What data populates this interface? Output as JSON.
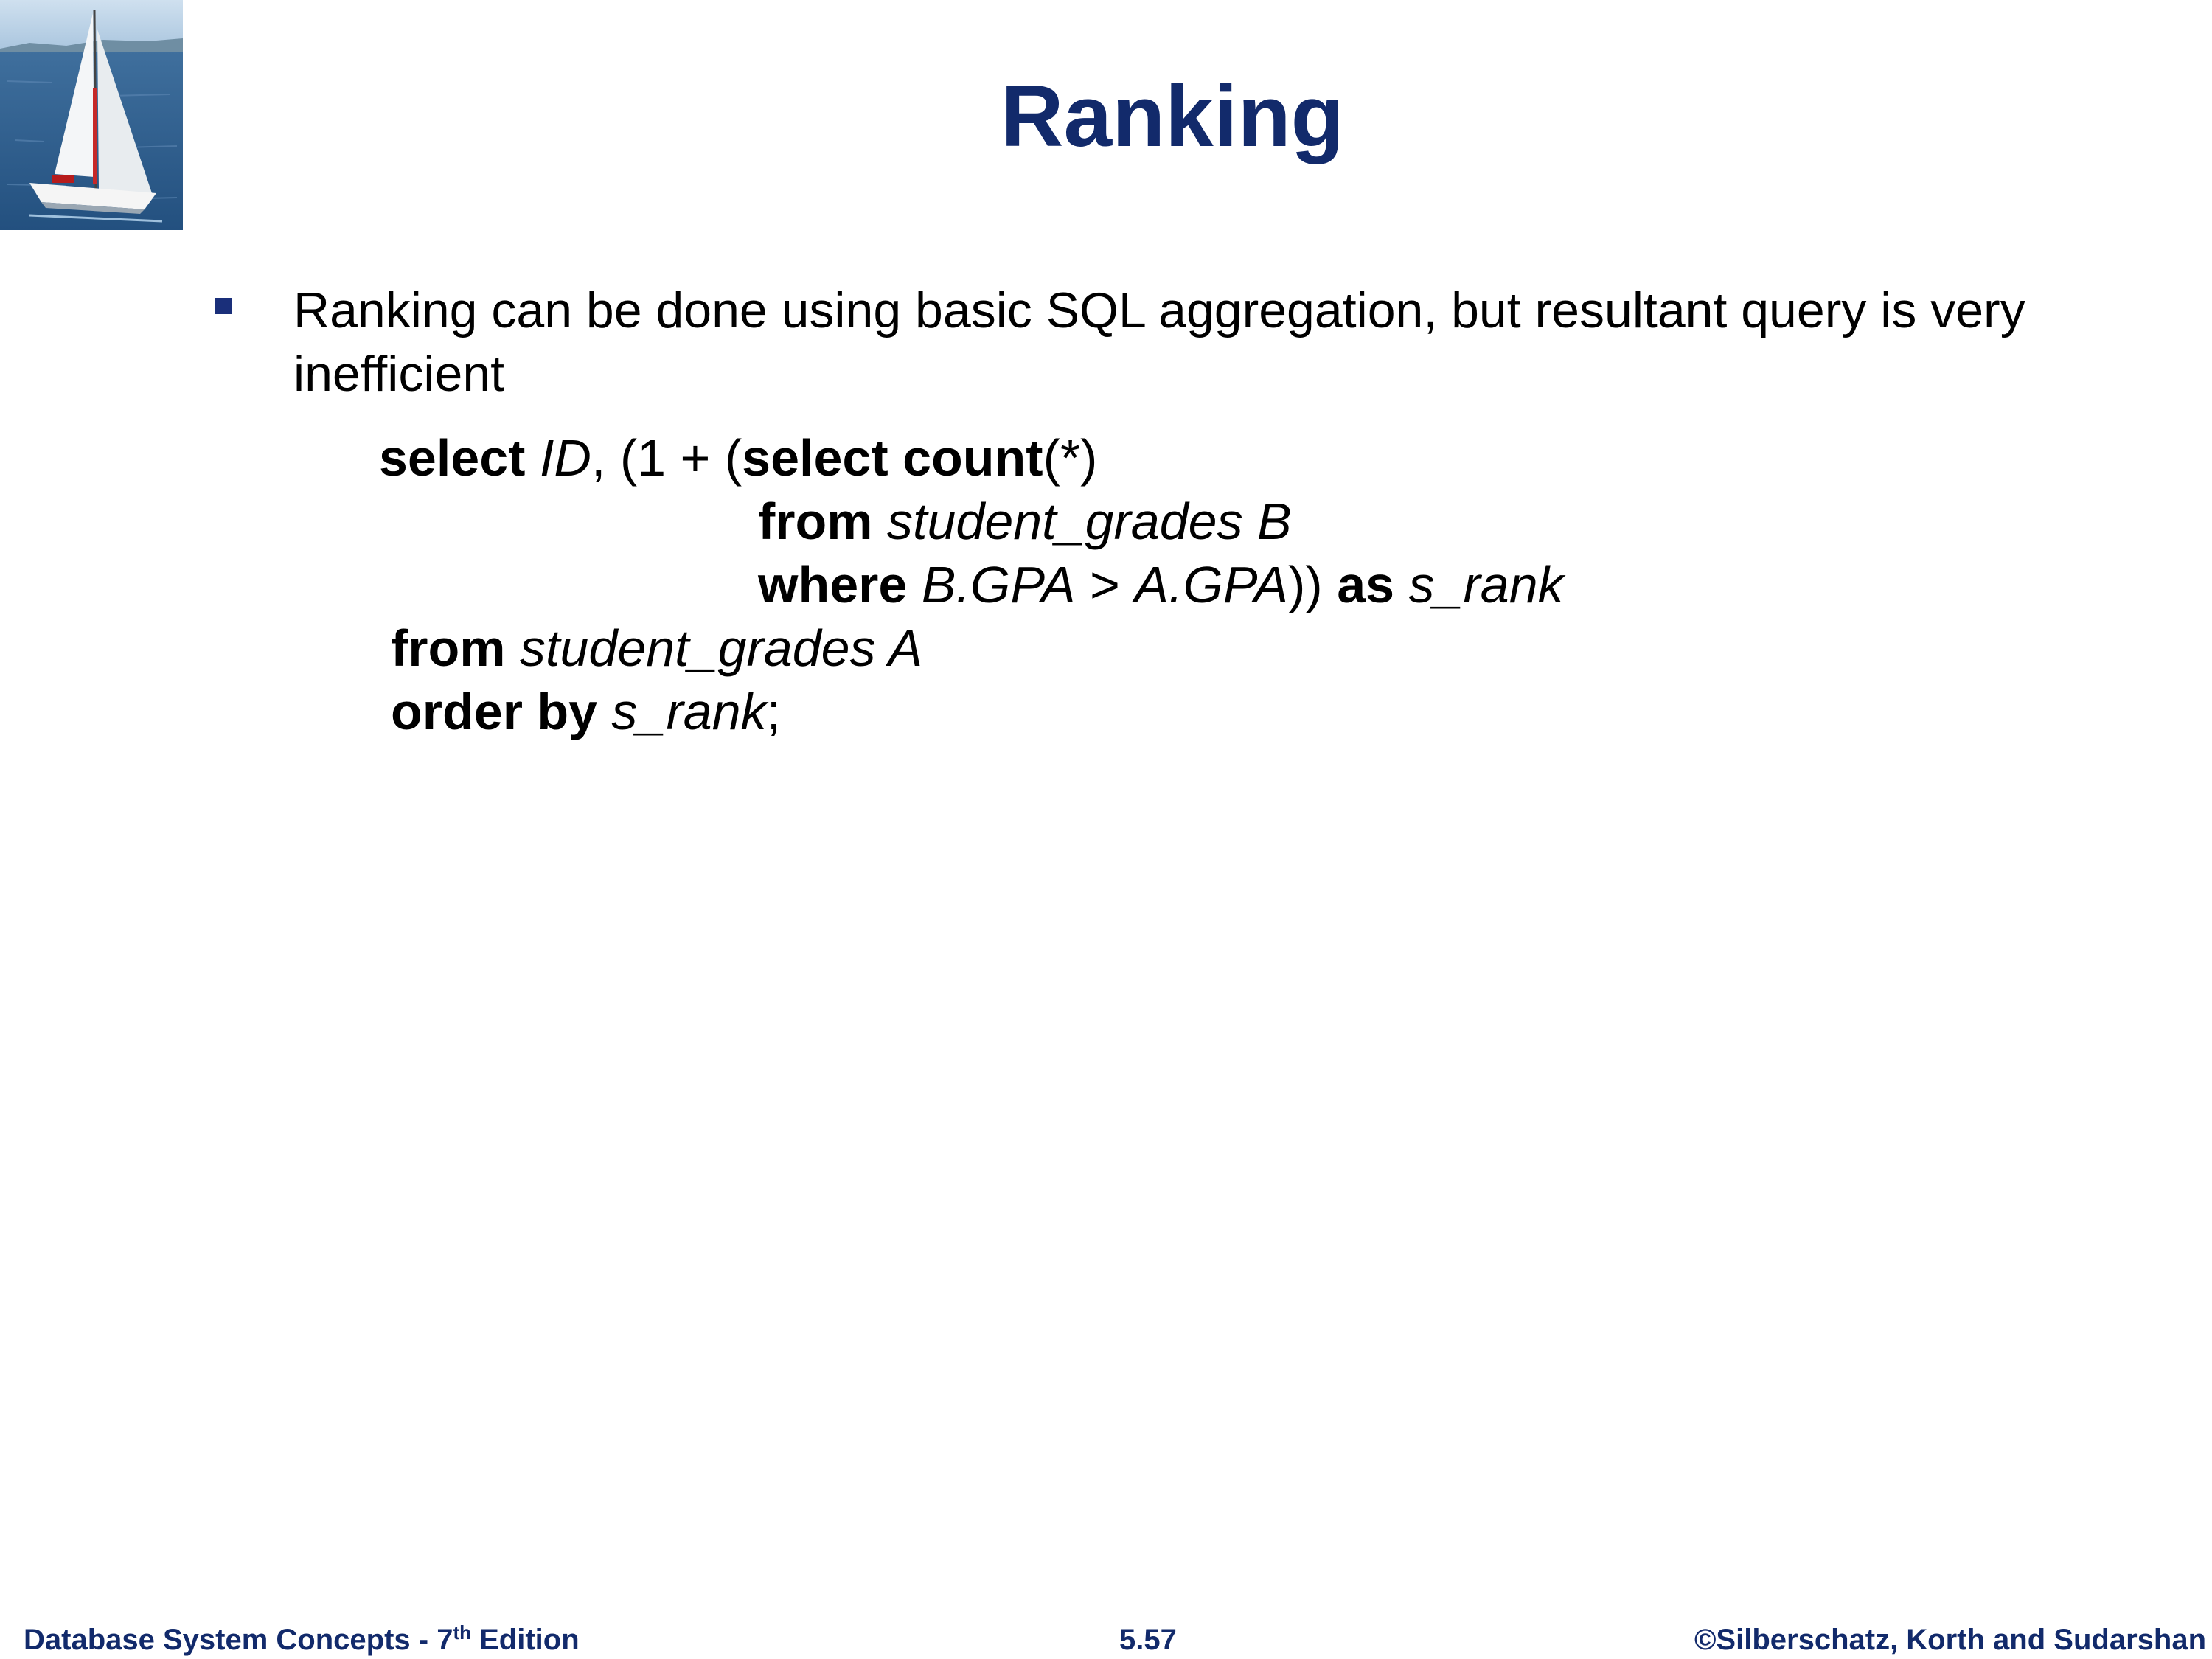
{
  "slide": {
    "title": "Ranking",
    "bullet": "Ranking can be done using basic SQL aggregation, but resultant query is very inefficient",
    "logo_icon": "sailboat-photo",
    "bullet_icon": "square-bullet-icon",
    "accent_color": "#122a6b"
  },
  "code": {
    "line1": {
      "kw_select": "select",
      "id": "ID",
      "open": ", (1 + (",
      "kw_select_count": "select count",
      "star": "(*)"
    },
    "line2": {
      "kw_from": "from",
      "table": "student_grades B"
    },
    "line3": {
      "kw_where": "where",
      "cond1": "B.GPA",
      "gt": " > ",
      "cond2": "A.GPA",
      "close": "))",
      "kw_as": "as",
      "alias": "s_rank"
    },
    "line4": {
      "kw_from": "from",
      "table": "student_grades A"
    },
    "line5": {
      "kw_order_by": "order by",
      "alias": "s_rank",
      "end": ";"
    }
  },
  "footer": {
    "left_prefix": "Database System Concepts - 7",
    "left_sup": "th",
    "left_suffix": " Edition",
    "center": "5.57",
    "right": "©Silberschatz, Korth and Sudarshan"
  }
}
